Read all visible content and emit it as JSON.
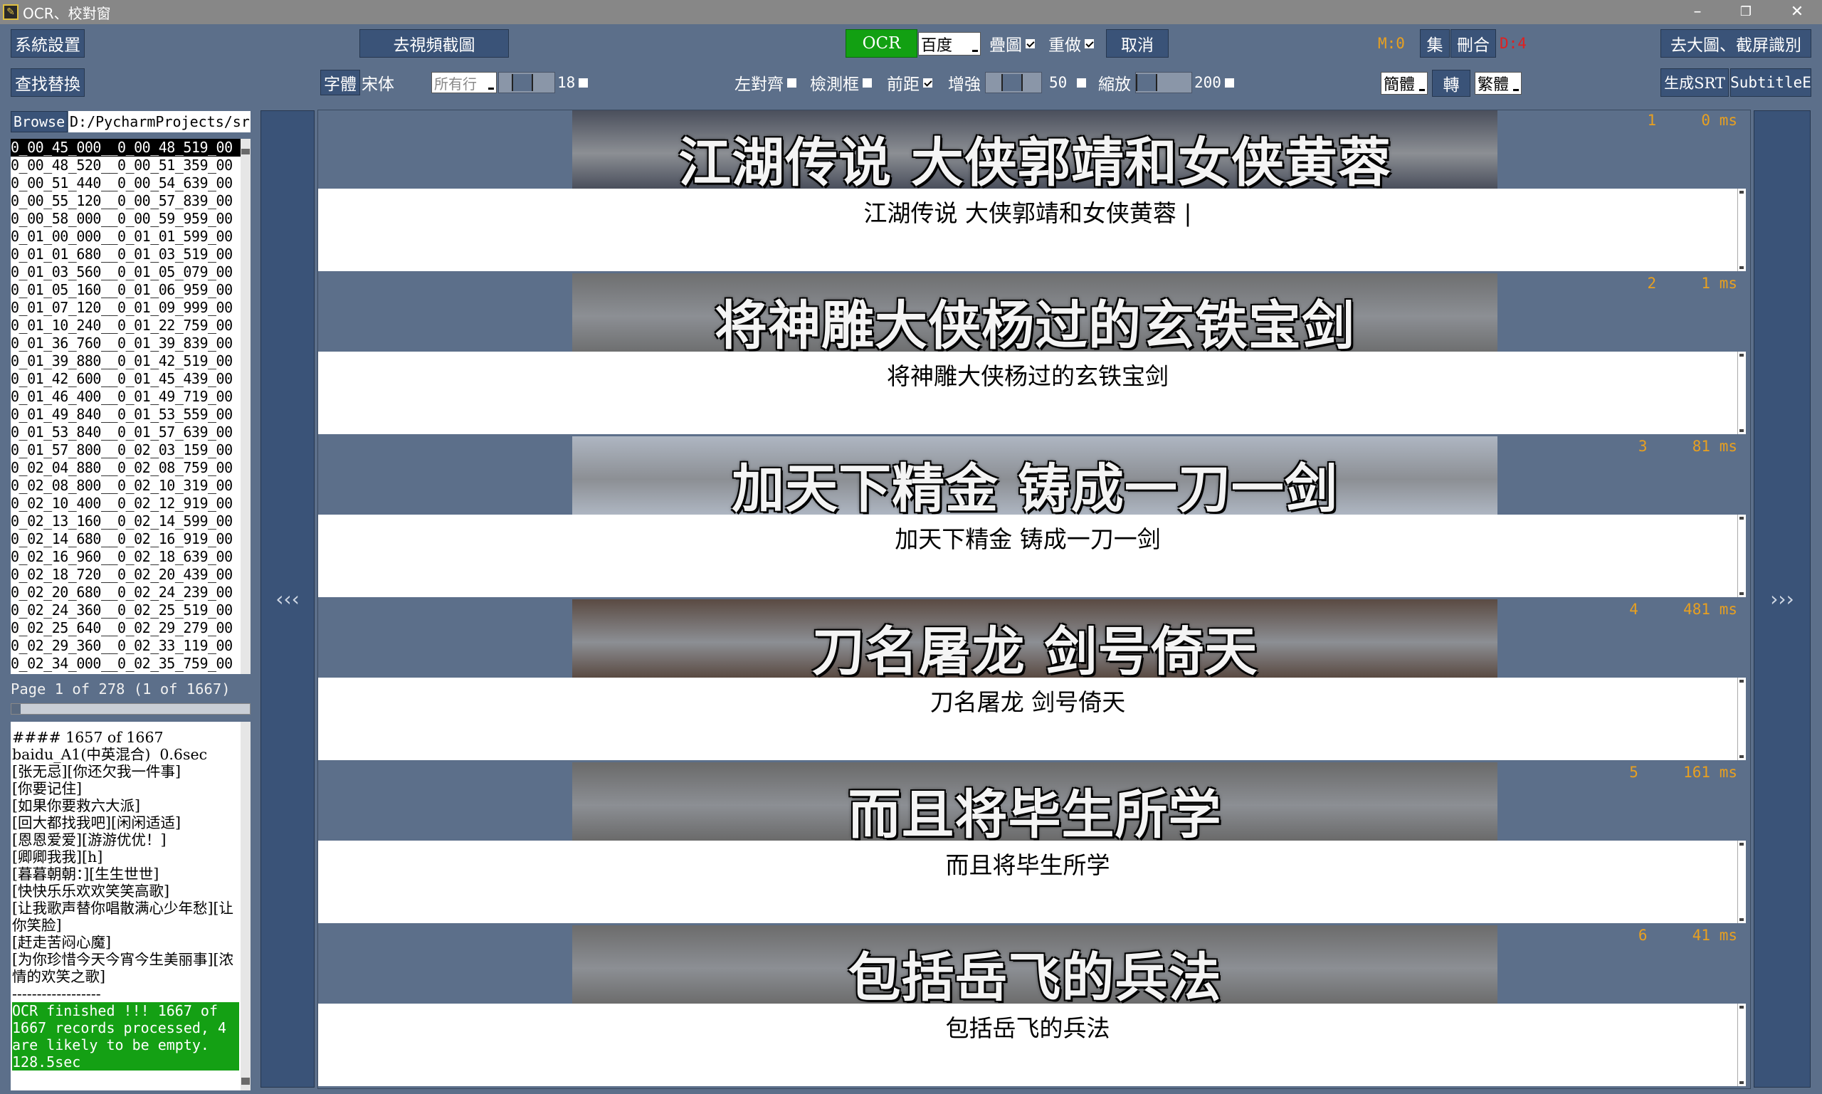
{
  "window": {
    "title": "OCR、校對窗",
    "minimize": "–",
    "restore": "❐",
    "close": "✕"
  },
  "toolbar1": {
    "settings": "系統設置",
    "goto_video": "去視頻截圖",
    "ocr": "OCR",
    "engine": "百度",
    "overlay": "疊圖",
    "redo": "重做",
    "cancel": "取消",
    "m_count": "M:0",
    "collect": "集",
    "delete_merge": "刪合",
    "d_count": "D:4",
    "big_image": "去大圖、截屏識別"
  },
  "toolbar2": {
    "find_replace": "查找替換",
    "font_label": "字體",
    "font_name": "宋体",
    "scope": "所有行",
    "font_size": "18",
    "align_left": "左對齊",
    "detect_box": "檢測框",
    "front_margin": "前距",
    "enhance": "增強",
    "enhance_value": "50",
    "zoom": "縮放",
    "zoom_value": "200",
    "simplified": "簡體",
    "convert": "轉",
    "traditional": "繁體",
    "gen_srt": "生成SRT",
    "subtitle_edit": "SubtitleE"
  },
  "browser": {
    "browse": "Browse",
    "path": "D:/PycharmProjects/sr",
    "items": [
      "0_00_45_000__0_00_48_519_00",
      "0_00_48_520__0_00_51_359_00",
      "0_00_51_440__0_00_54_639_00",
      "0_00_55_120__0_00_57_839_00",
      "0_00_58_000__0_00_59_959_00",
      "0_01_00_000__0_01_01_599_00",
      "0_01_01_680__0_01_03_519_00",
      "0_01_03_560__0_01_05_079_00",
      "0_01_05_160__0_01_06_959_00",
      "0_01_07_120__0_01_09_999_00",
      "0_01_10_240__0_01_22_759_00",
      "0_01_36_760__0_01_39_839_00",
      "0_01_39_880__0_01_42_519_00",
      "0_01_42_600__0_01_45_439_00",
      "0_01_46_400__0_01_49_719_00",
      "0_01_49_840__0_01_53_559_00",
      "0_01_53_840__0_01_57_639_00",
      "0_01_57_800__0_02_03_159_00",
      "0_02_04_880__0_02_08_759_00",
      "0_02_08_800__0_02_10_319_00",
      "0_02_10_400__0_02_12_919_00",
      "0_02_13_160__0_02_14_599_00",
      "0_02_14_680__0_02_16_919_00",
      "0_02_16_960__0_02_18_639_00",
      "0_02_18_720__0_02_20_439_00",
      "0_02_20_680__0_02_24_239_00",
      "0_02_24_360__0_02_25_519_00",
      "0_02_25_640__0_02_29_279_00",
      "0_02_29_360__0_02_33_119_00",
      "0_02_34_000__0_02_35_759_00"
    ],
    "page_info": "Page 1 of 278 (1 of 1667)",
    "progress": 0.04
  },
  "log": {
    "lines": [
      "#### 1657 of 1667",
      "baidu_A1(中英混合)  0.6sec",
      "[张无忌][你还欠我一件事]",
      "[你要记住]",
      "[如果你要救六大派]",
      "[回大都找我吧][闲闲适适]",
      "[恩恩爱爱][游游优优！]",
      "[卿卿我我][h]",
      "[暮暮朝朝：][生生世世]",
      "[快快乐乐欢欢笑笑高歌]",
      "[让我歌声替你唱散满心少年愁][让你笑脸]",
      "[赶走苦闷心魔]",
      "[为你珍惜今天今宵今生美丽事][浓情的欢笑之歌]",
      "------------------"
    ],
    "finished": "OCR finished !!!  1667 of 1667 records processed, 4 are likely to be empty. 128.5sec"
  },
  "nav": {
    "prev": "‹‹‹",
    "next": "›››"
  },
  "entries": [
    {
      "index": "1",
      "ms": "0 ms",
      "caption": "江湖传说  大侠郭靖和女侠黄蓉",
      "text": "江湖传说  大侠郭靖和女侠黄蓉 |",
      "bg": "#4a4f5c"
    },
    {
      "index": "2",
      "ms": "1 ms",
      "caption": "将神雕大侠杨过的玄铁宝剑",
      "text": "将神雕大侠杨过的玄铁宝剑",
      "bg": "#6e6f70"
    },
    {
      "index": "3",
      "ms": "81 ms",
      "caption": "加天下精金  铸成一刀一剑",
      "text": "加天下精金  铸成一刀一剑",
      "bg": "#aeb6c2"
    },
    {
      "index": "4",
      "ms": "481 ms",
      "caption": "刀名屠龙  剑号倚天",
      "text": "刀名屠龙  剑号倚天",
      "bg": "#5a4a42"
    },
    {
      "index": "5",
      "ms": "161 ms",
      "caption": "而且将毕生所学",
      "text": "而且将毕生所学",
      "bg": "#6a6a6a"
    },
    {
      "index": "6",
      "ms": "41 ms",
      "caption": "包括岳飞的兵法",
      "text": "包括岳飞的兵法",
      "bg": "#6c6c6c"
    }
  ],
  "colors": {
    "bg": "#5c6f8a",
    "button": "#3a5378",
    "ocr_active": "#12a012",
    "accent_orange": "#e8a020",
    "accent_red": "#e02020"
  }
}
